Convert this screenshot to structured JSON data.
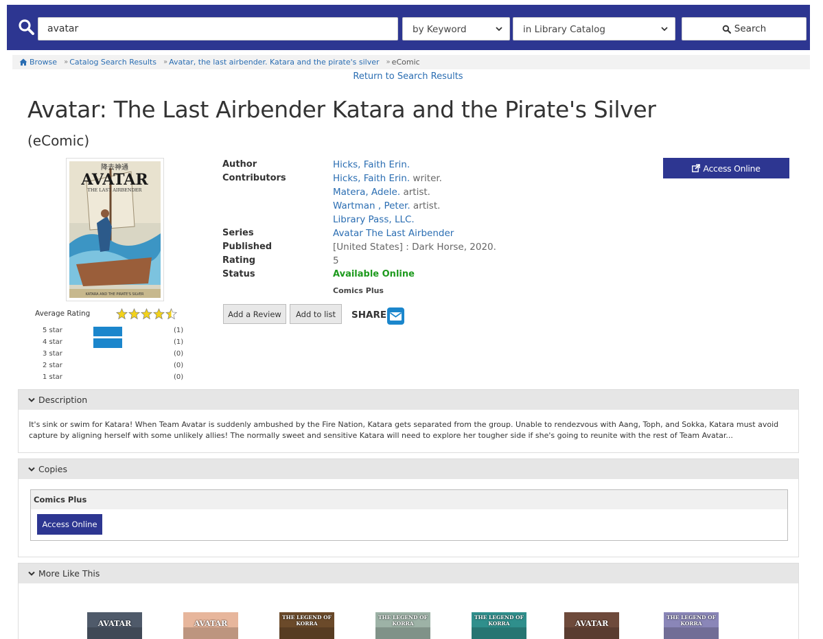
{
  "search": {
    "query": "avatar",
    "type_label": "by Keyword",
    "scope_label": "in Library Catalog",
    "button_label": "Search"
  },
  "breadcrumb": {
    "items": [
      "Browse",
      "Catalog Search Results",
      "Avatar, the last airbender. Katara and the pirate's silver",
      "eComic"
    ],
    "separator": "»"
  },
  "return_link": "Return to Search Results",
  "title": "Avatar: The Last Airbender Katara and the Pirate's Silver",
  "format": "(eComic)",
  "cover": {
    "top_glyphs": "降去神通",
    "logo": "AVATAR",
    "subtitle": "THE LAST AIRBENDER",
    "footer": "KATARA AND THE PIRATE'S SILVER"
  },
  "details": {
    "author_label": "Author",
    "author": "Hicks, Faith Erin.",
    "contributors_label": "Contributors",
    "contributors": [
      {
        "name": "Hicks, Faith Erin.",
        "role": " writer."
      },
      {
        "name": "Matera, Adele.",
        "role": " artist."
      },
      {
        "name": "Wartman , Peter.",
        "role": " artist."
      },
      {
        "name": "Library Pass, LLC.",
        "role": ""
      }
    ],
    "series_label": "Series",
    "series": "Avatar The Last Airbender",
    "published_label": "Published",
    "published": "[United States] : Dark Horse, 2020.",
    "rating_label": "Rating",
    "rating": "5",
    "status_label": "Status",
    "status": "Available Online",
    "source": "Comics Plus"
  },
  "actions": {
    "review": "Add a Review",
    "list": "Add to list",
    "share": "SHARE",
    "access_online": "Access Online"
  },
  "ratings": {
    "average_label": "Average Rating",
    "average": 4.5,
    "rows": [
      {
        "label": "5 star",
        "count": "(1)",
        "fraction": 0.5
      },
      {
        "label": "4 star",
        "count": "(1)",
        "fraction": 0.5
      },
      {
        "label": "3 star",
        "count": "(0)",
        "fraction": 0
      },
      {
        "label": "2 star",
        "count": "(0)",
        "fraction": 0
      },
      {
        "label": "1 star",
        "count": "(0)",
        "fraction": 0
      }
    ]
  },
  "description": {
    "heading": "Description",
    "text": "It's sink or swim for Katara! When Team Avatar is suddenly ambushed by the Fire Nation, Katara gets separated from the group. Unable to rendezvous with Aang, Toph, and Sokka, Katara must avoid capture by aligning herself with some unlikely allies! The normally sweet and sensitive Katara will need to explore her tougher side if she's going to reunite with the rest of Team Avatar..."
  },
  "copies": {
    "heading": "Copies",
    "source": "Comics Plus",
    "button": "Access Online"
  },
  "more_like_this": {
    "heading": "More Like This",
    "thumbs": [
      {
        "text": "AVATAR",
        "bg": "#4f5a6a"
      },
      {
        "text": "AVATAR",
        "bg": "#e7b69c"
      },
      {
        "text": "THE LEGEND OF KORRA",
        "bg": "#6b4a2a"
      },
      {
        "text": "THE LEGEND OF KORRA",
        "bg": "#9db2a6"
      },
      {
        "text": "THE LEGEND OF KORRA",
        "bg": "#2f8f8c"
      },
      {
        "text": "AVATAR",
        "bg": "#6e4a3b"
      },
      {
        "text": "THE LEGEND OF KORRA",
        "bg": "#8a86b8"
      }
    ]
  },
  "colors": {
    "brand": "#2d3691",
    "link": "#2a6db2",
    "available": "#1d9a1d",
    "rating_bar": "#1b86cc",
    "star": "#f3d21a"
  }
}
